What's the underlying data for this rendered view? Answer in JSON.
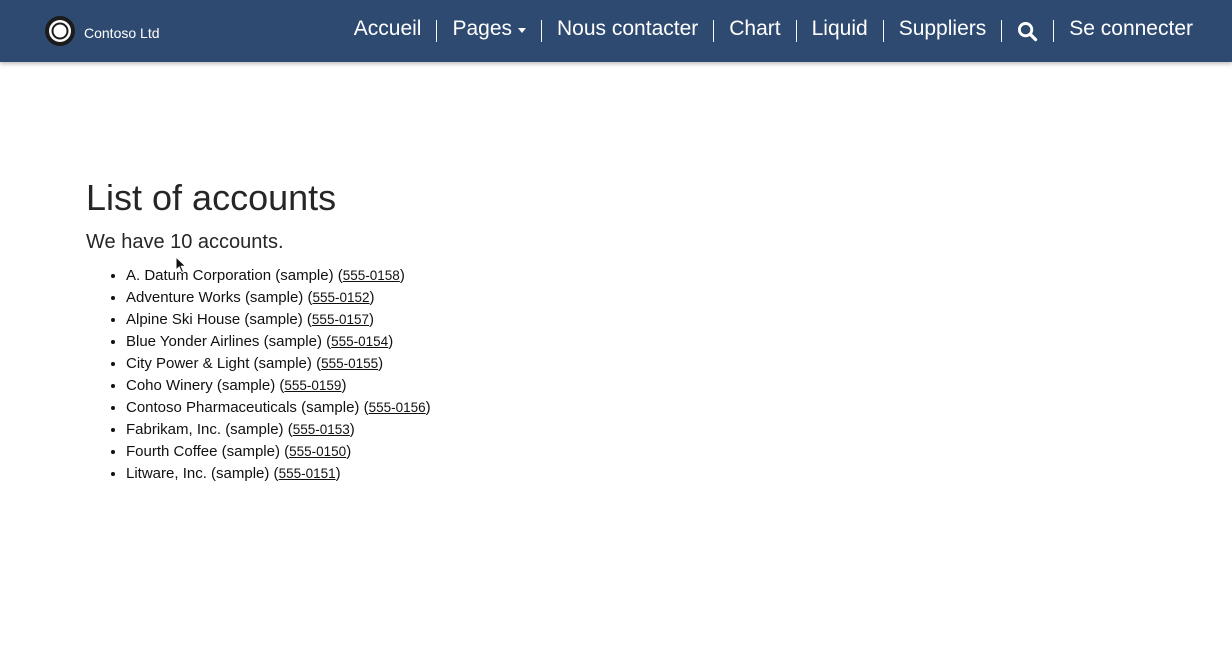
{
  "brand": {
    "name": "Contoso Ltd",
    "logo_icon": "contoso-logo-icon"
  },
  "nav": {
    "home": "Accueil",
    "pages": "Pages",
    "contact": "Nous contacter",
    "chart": "Chart",
    "liquid": "Liquid",
    "suppliers": "Suppliers",
    "search_icon": "search-icon",
    "signin": "Se connecter"
  },
  "colors": {
    "navbar": "#2f4a70",
    "nav_text": "#ffffff",
    "body_text": "#262626"
  },
  "main": {
    "title": "List of accounts",
    "summary": "We have 10 accounts.",
    "accounts": [
      {
        "name": "A. Datum Corporation (sample)",
        "phone": "555-0158"
      },
      {
        "name": "Adventure Works (sample)",
        "phone": "555-0152"
      },
      {
        "name": "Alpine Ski House (sample)",
        "phone": "555-0157"
      },
      {
        "name": "Blue Yonder Airlines (sample)",
        "phone": "555-0154"
      },
      {
        "name": "City Power & Light (sample)",
        "phone": "555-0155"
      },
      {
        "name": "Coho Winery (sample)",
        "phone": "555-0159"
      },
      {
        "name": "Contoso Pharmaceuticals (sample)",
        "phone": "555-0156"
      },
      {
        "name": "Fabrikam, Inc. (sample)",
        "phone": "555-0153"
      },
      {
        "name": "Fourth Coffee (sample)",
        "phone": "555-0150"
      },
      {
        "name": "Litware, Inc. (sample)",
        "phone": "555-0151"
      }
    ]
  }
}
